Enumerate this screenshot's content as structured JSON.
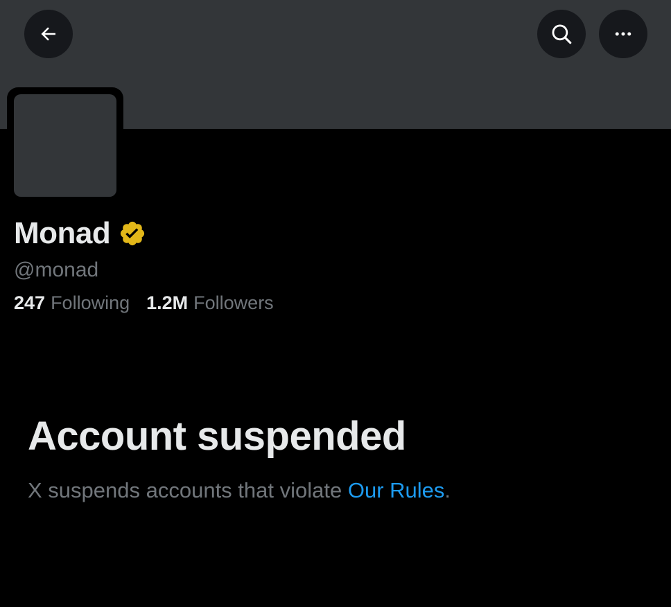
{
  "header": {
    "back_icon": "arrow-left-icon",
    "search_icon": "search-icon",
    "more_icon": "more-horizontal-icon"
  },
  "profile": {
    "display_name": "Monad",
    "verified_icon": "verified-gold-badge-icon",
    "handle": "@monad",
    "following_count": "247",
    "following_label": "Following",
    "followers_count": "1.2M",
    "followers_label": "Followers"
  },
  "suspension": {
    "title": "Account suspended",
    "message": "X suspends accounts that violate ",
    "rules_link": "Our Rules",
    "message_end": "."
  },
  "colors": {
    "background": "#000000",
    "banner": "#333639",
    "primary_text": "#e7e9ea",
    "secondary_text": "#71767b",
    "link": "#1d9bf0",
    "verified_gold": "#e2b719"
  }
}
